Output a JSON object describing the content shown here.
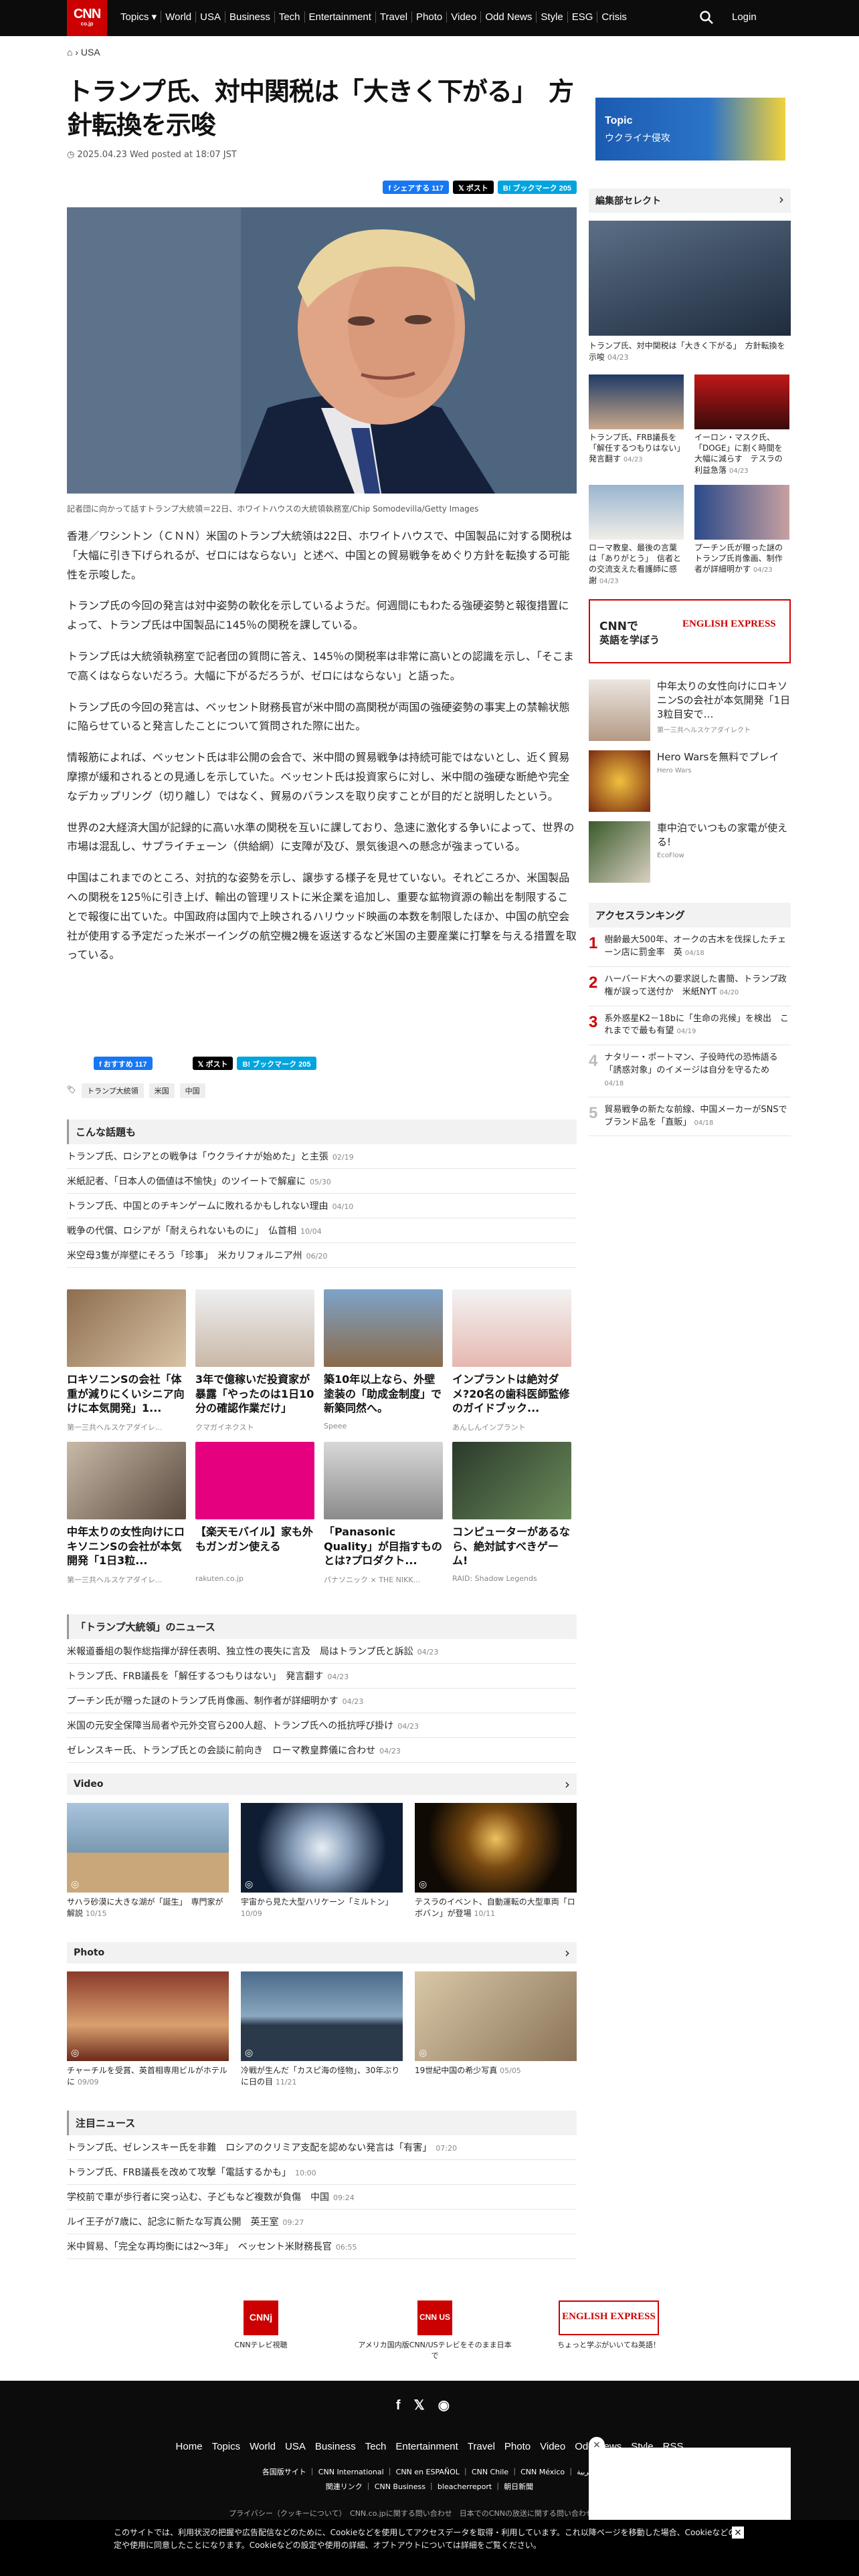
{
  "header": {
    "logo": "CNN",
    "logo_sub": "co.jp",
    "nav": [
      "Topics ▾",
      "World",
      "USA",
      "Business",
      "Tech",
      "Entertainment",
      "Travel",
      "Photo",
      "Video",
      "Odd News",
      "Style",
      "ESG",
      "Crisis"
    ],
    "login": "Login"
  },
  "breadcrumb": {
    "home": "⌂",
    "sep": "›",
    "current": "USA"
  },
  "article": {
    "title": "トランプ氏、対中関税は「大きく下がる」　方針転換を示唆",
    "date": "2025.04.23 Wed posted at 18:07 JST",
    "share": {
      "fb": "f シェアする 117",
      "x": "𝕏 ポスト",
      "hb": "B! ブックマーク 205"
    },
    "caption": "記者団に向かって話すトランプ大統領＝22日、ホワイトハウスの大統領執務室/Chip Somodevilla/Getty Images",
    "paragraphs": [
      "香港／ワシントン（ＣＮＮ）米国のトランプ大統領は22日、ホワイトハウスで、中国製品に対する関税は「大幅に引き下げられるが、ゼロにはならない」と述べ、中国との貿易戦争をめぐり方針を転換する可能性を示唆した。",
      "トランプ氏の今回の発言は対中姿勢の軟化を示しているようだ。何週間にもわたる強硬姿勢と報復措置によって、トランプ氏は中国製品に145％の関税を課している。",
      "トランプ氏は大統領執務室で記者団の質問に答え、145％の関税率は非常に高いとの認識を示し、「そこまで高くはならないだろう。大幅に下がるだろうが、ゼロにはならない」と語った。",
      "トランプ氏の今回の発言は、ベッセント財務長官が米中間の高関税が両国の強硬姿勢の事実上の禁輸状態に陥らせていると発言したことについて質問された際に出た。",
      "情報筋によれば、ベッセント氏は非公開の会合で、米中間の貿易戦争は持続可能ではないとし、近く貿易摩擦が緩和されるとの見通しを示していた。ベッセント氏は投資家らに対し、米中間の強硬な断絶や完全なデカップリング（切り離し）ではなく、貿易のバランスを取り戻すことが目的だと説明したという。",
      "世界の2大経済大国が記録的に高い水準の関税を互いに課しており、急速に激化する争いによって、世界の市場は混乱し、サプライチェーン（供給網）に支障が及び、景気後退への懸念が強まっている。",
      "中国はこれまでのところ、対抗的な姿勢を示し、譲歩する様子を見せていない。それどころか、米国製品への関税を125％に引き上げ、輸出の管理リストに米企業を追加し、重要な鉱物資源の輸出を制限することで報復に出ていた。中国政府は国内で上映されるハリウッド映画の本数を制限したほか、中国の航空会社が使用する予定だった米ボーイングの航空機2機を返送するなど米国の主要産業に打撃を与える措置を取っている。"
    ],
    "share2": {
      "fb": "f おすすめ 117",
      "x": "𝕏 ポスト",
      "hb": "B! ブックマーク 205"
    },
    "tags": [
      "トランプ大統領",
      "米国",
      "中国"
    ]
  },
  "related": {
    "title": "こんな話題も",
    "items": [
      {
        "t": "トランプ氏、ロシアとの戦争は「ウクライナが始めた」と主張",
        "d": "02/19"
      },
      {
        "t": "米紙記者、「日本人の価値は不愉快」のツイートで解雇に",
        "d": "05/30"
      },
      {
        "t": "トランプ氏、中国とのチキンゲームに敗れるかもしれない理由",
        "d": "04/10"
      },
      {
        "t": "戦争の代償、ロシアが「耐えられないものに」　仏首相",
        "d": "10/04"
      },
      {
        "t": "米空母3隻が岸壁にそろう「珍事」　米カリフォルニア州",
        "d": "06/20"
      }
    ]
  },
  "ads": [
    {
      "t": "ロキソニンSの会社「体重が減りにくいシニア向けに本気開発」1...",
      "s": "第一三共ヘルスケアダイレ..."
    },
    {
      "t": "3年で億稼いだ投資家が暴露「やったのは1日10分の確認作業だけ」",
      "s": "クマガイネクスト"
    },
    {
      "t": "築10年以上なら、外壁塗装の「助成金制度」で新築同然へ。",
      "s": "Speee"
    },
    {
      "t": "インプラントは絶対ダメ?20名の歯科医師監修のガイドブック...",
      "s": "あんしんインプラント"
    },
    {
      "t": "中年太りの女性向けにロキソニンSの会社が本気開発「1日3粒...",
      "s": "第一三共ヘルスケアダイレ..."
    },
    {
      "t": "【楽天モバイル】家も外もガンガン使える",
      "s": "rakuten.co.jp"
    },
    {
      "t": "「Panasonic Quality」が目指すものとは?プロダクト...",
      "s": "パナソニック × THE NIKK..."
    },
    {
      "t": "コンピューターがあるなら、絶対試すべきゲーム!",
      "s": "RAID: Shadow Legends"
    }
  ],
  "trump_news": {
    "title": "「トランプ大統領」のニュース",
    "items": [
      {
        "t": "米報道番組の製作総指揮が辞任表明、独立性の喪失に言及　局はトランプ氏と訴訟",
        "d": "04/23"
      },
      {
        "t": "トランプ氏、FRB議長を「解任するつもりはない」　発言翻す",
        "d": "04/23"
      },
      {
        "t": "プーチン氏が贈った謎のトランプ氏肖像画、制作者が詳細明かす",
        "d": "04/23"
      },
      {
        "t": "米国の元安全保障当局者や元外交官ら200人超、トランプ氏への抵抗呼び掛け",
        "d": "04/23"
      },
      {
        "t": "ゼレンスキー氏、トランプ氏との会談に前向き　ローマ教皇葬儀に合わせ",
        "d": "04/23"
      }
    ]
  },
  "video": {
    "title": "Video",
    "items": [
      {
        "t": "サハラ砂漠に大きな湖が「誕生」　専門家が解説",
        "d": "10/15"
      },
      {
        "t": "宇宙から見た大型ハリケーン「ミルトン」",
        "d": "10/09"
      },
      {
        "t": "テスラのイベント、自動運転の大型車両「ロボバン」が登場",
        "d": "10/11"
      }
    ]
  },
  "photo": {
    "title": "Photo",
    "items": [
      {
        "t": "チャーチルを受賞、英首相専用ビルがホテルに",
        "d": "09/09"
      },
      {
        "t": "冷戦が生んだ「カスピ海の怪物」、30年ぶりに日の目",
        "d": "11/21"
      },
      {
        "t": "19世紀中国の希少写真",
        "d": "05/05"
      }
    ]
  },
  "featured": {
    "title": "注目ニュース",
    "items": [
      {
        "t": "トランプ氏、ゼレンスキー氏を非難　ロシアのクリミア支配を認めない発言は「有害」",
        "d": "07:20"
      },
      {
        "t": "トランプ氏、FRB議長を改めて攻撃「電話するかも」",
        "d": "10:00"
      },
      {
        "t": "学校前で車が歩行者に突っ込む、子どもなど複数が負傷　中国",
        "d": "09:24"
      },
      {
        "t": "ルイ王子が7歳に、記念に新たな写真公開　英王室",
        "d": "09:27"
      },
      {
        "t": "米中貿易、「完全な再均衡には2～3年」　ベッセント米財務長官",
        "d": "06:55"
      }
    ]
  },
  "promos": [
    {
      "logo": "CNNj",
      "t": "CNNテレビ視聴"
    },
    {
      "logo": "CNN US",
      "t": "アメリカ国内版CNN/USテレビをそのまま日本で"
    },
    {
      "logo": "ENGLISH EXPRESS",
      "t": "ちょっと学ぶがいいてね英語！"
    }
  ],
  "sidebar": {
    "topic": {
      "tag": "Topic",
      "title": "ウクライナ侵攻"
    },
    "editor": {
      "title": "編集部セレクト",
      "lead": {
        "t": "トランプ氏、対中関税は「大きく下がる」　方針転換を示唆",
        "d": "04/23"
      },
      "items": [
        {
          "t": "トランプ氏、FRB議長を「解任するつもりはない」　発言翻す",
          "d": "04/23"
        },
        {
          "t": "イーロン・マスク氏、「DOGE」に割く時間を大幅に減らす　テスラの利益急落",
          "d": "04/23"
        },
        {
          "t": "ローマ教皇、最後の言葉は「ありがとう」　信者との交流支えた看護師に感謝",
          "d": "04/23"
        },
        {
          "t": "プーチン氏が贈った謎のトランプ氏肖像画、制作者が詳細明かす",
          "d": "04/23"
        }
      ]
    },
    "english": {
      "a": "CNNで",
      "b": "英語を学ぼう",
      "logo": "ENGLISH EXPRESS"
    },
    "ads": [
      {
        "t": "中年太りの女性向けにロキソニンSの会社が本気開発「1日3粒目安で…",
        "s": "第一三共ヘルスケアダイレクト"
      },
      {
        "t": "Hero Warsを無料でプレイ",
        "s": "Hero Wars"
      },
      {
        "t": "車中泊でいつもの家電が使える!",
        "s": "EcoFlow"
      }
    ],
    "ranking": {
      "title": "アクセスランキング",
      "items": [
        {
          "n": "1",
          "t": "樹齢最大500年、オークの古木を伐採したチェーン店に罰金率　英",
          "d": "04/18"
        },
        {
          "n": "2",
          "t": "ハーバード大への要求説した書簡、トランプ政権が誤って送付か　米紙NYT",
          "d": "04/20"
        },
        {
          "n": "3",
          "t": "系外惑星K2－18bに「生命の兆候」を検出　これまでで最も有望",
          "d": "04/19"
        },
        {
          "n": "4",
          "t": "ナタリー・ポートマン、子役時代の恐怖語る「誘惑対象」のイメージは自分を守るため",
          "d": "04/18"
        },
        {
          "n": "5",
          "t": "貿易戦争の新たな前線、中国メーカーがSNSでブランド品を「直販」",
          "d": "04/18"
        }
      ]
    }
  },
  "footer": {
    "nav": [
      "Home",
      "Topics",
      "World",
      "USA",
      "Business",
      "Tech",
      "Entertainment",
      "Travel",
      "Photo",
      "Video",
      "Odd News",
      "Style",
      "RSS"
    ],
    "row2": "各国版サイト ｜ CNN International ｜ CNN en ESPAÑOL ｜ CNN Chile ｜ CNN México ｜ العربية",
    "row3": "関連リンク ｜ CNN Business ｜ bleacherreport ｜ 朝日新聞",
    "row4": "プライバシー（クッキーについて）　CNN.co.jpに関する問い合わせ　日本でのCNNの放送に関する問い合わせ　広告掲載",
    "cookie": "このサイトでは、利用状況の把握や広告配信などのために、Cookieなどを使用してアクセスデータを取得・利用しています。これ以降ページを移動した場合、Cookieなどの設定や使用に同意したことになります。Cookieなどの設定や使用の詳細、オプトアウトについては詳細をご覧ください。"
  }
}
